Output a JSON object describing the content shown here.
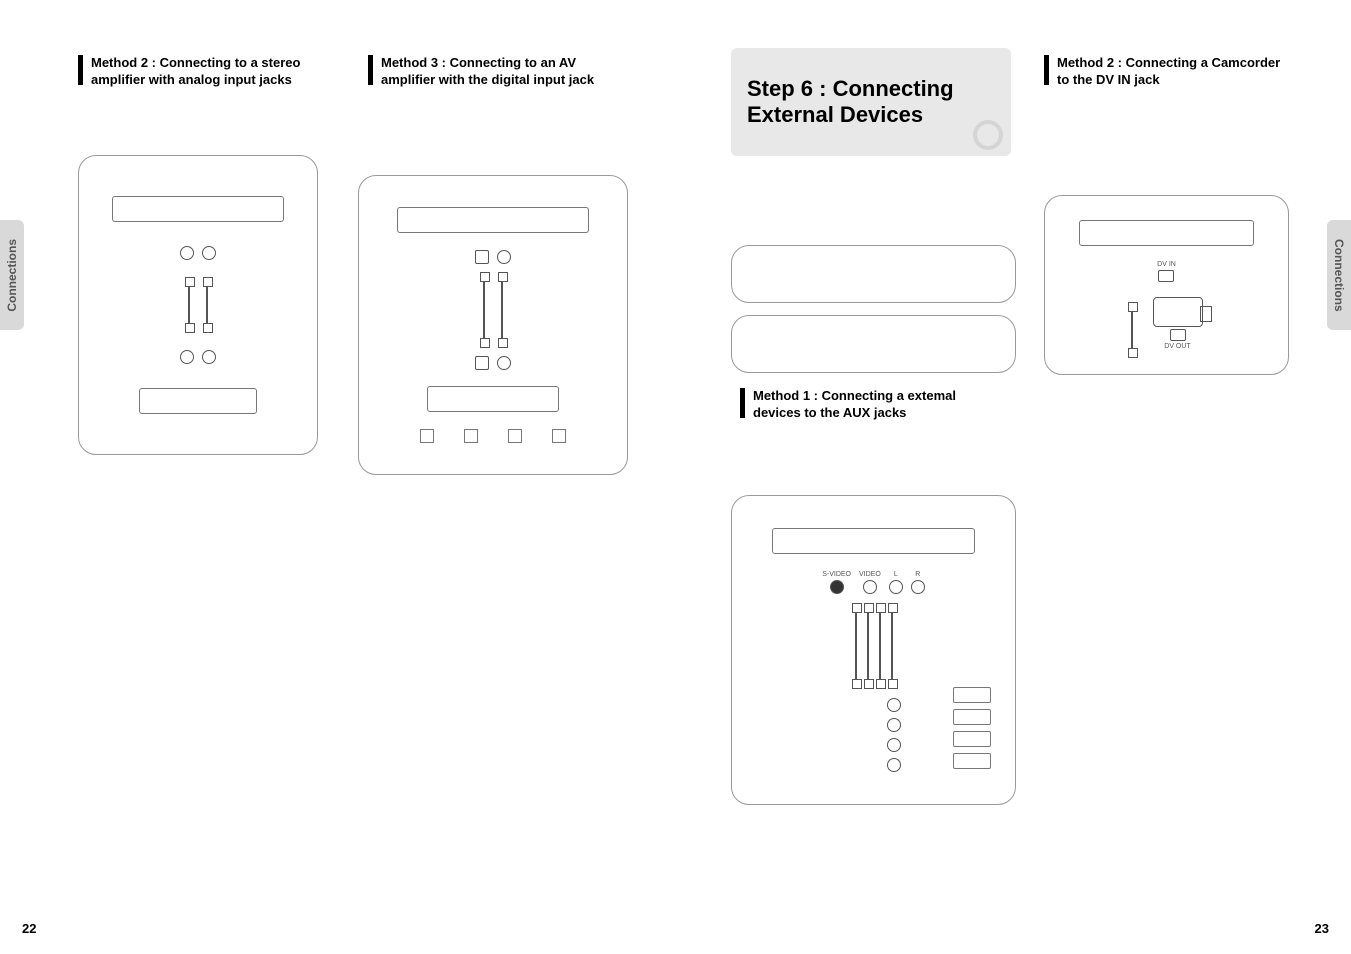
{
  "side_tab_label": "Connections",
  "left_page": {
    "page_number": "22",
    "method2_heading": "Method 2 : Connecting to a stereo amplifier with analog input jacks",
    "method3_heading": "Method 3 : Connecting to an AV amplifier with the digital input jack"
  },
  "right_page": {
    "page_number": "23",
    "step_title_line1": "Step 6 : Connecting",
    "step_title_line2": "External Devices",
    "method2_heading": "Method 2 : Connecting a Camcorder to the DV IN jack",
    "method1_heading": "Method 1 : Connecting a extemal devices to the AUX jacks",
    "dv_in_label": "DV IN",
    "dv_out_label": "DV OUT",
    "aux_port_labels": [
      "S-VIDEO",
      "VIDEO",
      "L",
      "R"
    ]
  }
}
